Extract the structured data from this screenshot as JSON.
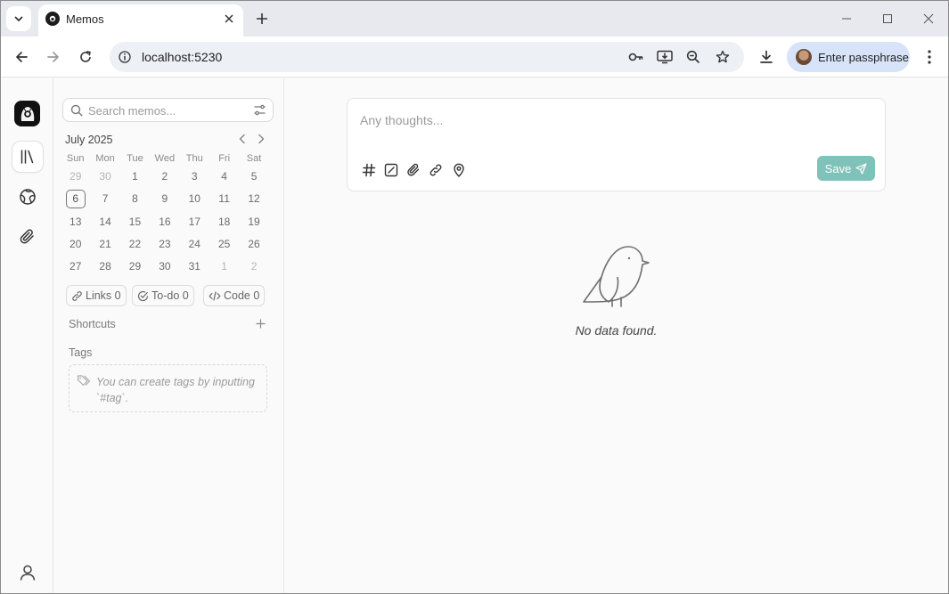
{
  "browser": {
    "tab_title": "Memos",
    "url": "localhost:5230",
    "profile_label": "Enter passphrase"
  },
  "search": {
    "placeholder": "Search memos..."
  },
  "calendar": {
    "month_label": "July 2025",
    "weekdays": [
      "Sun",
      "Mon",
      "Tue",
      "Wed",
      "Thu",
      "Fri",
      "Sat"
    ],
    "weeks": [
      [
        "29",
        "30",
        "1",
        "2",
        "3",
        "4",
        "5"
      ],
      [
        "6",
        "7",
        "8",
        "9",
        "10",
        "11",
        "12"
      ],
      [
        "13",
        "14",
        "15",
        "16",
        "17",
        "18",
        "19"
      ],
      [
        "20",
        "21",
        "22",
        "23",
        "24",
        "25",
        "26"
      ],
      [
        "27",
        "28",
        "29",
        "30",
        "31",
        "1",
        "2"
      ]
    ],
    "outside_month": [
      [
        0,
        0
      ],
      [
        0,
        1
      ],
      [
        4,
        5
      ],
      [
        4,
        6
      ]
    ],
    "today": [
      1,
      0
    ]
  },
  "stats": {
    "links": "Links 0",
    "todo": "To-do 0",
    "code": "Code 0"
  },
  "shortcuts": {
    "label": "Shortcuts"
  },
  "tags": {
    "label": "Tags",
    "empty_text": "You can create tags by inputting `#tag`."
  },
  "editor": {
    "placeholder": "Any thoughts...",
    "save_label": "Save"
  },
  "empty_state": {
    "text": "No data found."
  },
  "colors": {
    "save_button": "#7fc2b9",
    "profile_chip": "#d7e3f8",
    "omnibox": "#edf0f5"
  }
}
